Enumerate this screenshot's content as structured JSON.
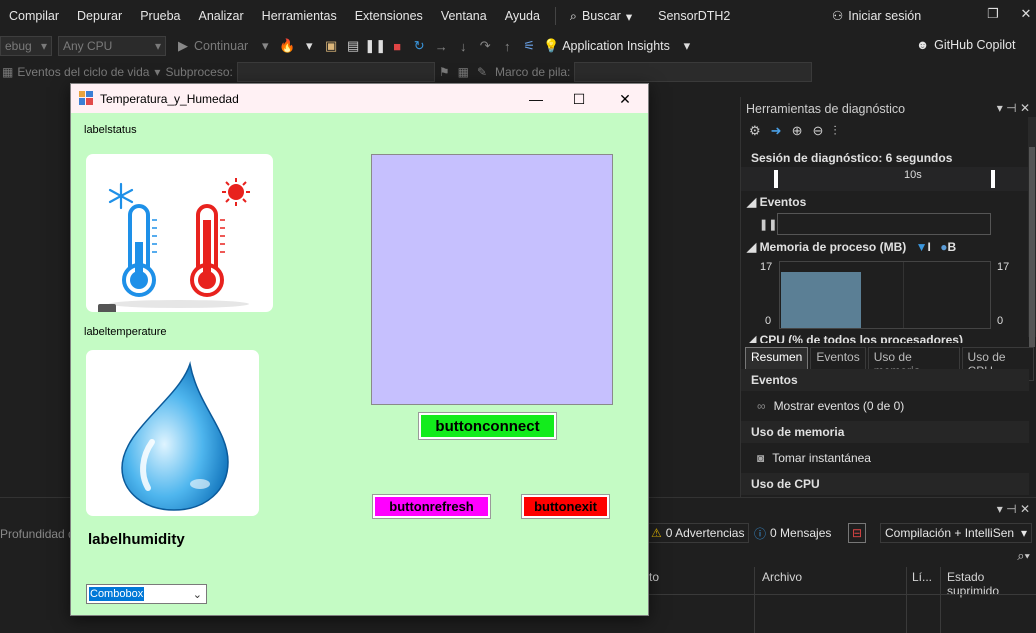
{
  "menubar": {
    "items": [
      "Compilar",
      "Depurar",
      "Prueba",
      "Analizar",
      "Herramientas",
      "Extensiones",
      "Ventana",
      "Ayuda"
    ],
    "search": "Buscar",
    "project": "SensorDTH2",
    "signin": "Iniciar sesión"
  },
  "toolbar": {
    "config": "ebug",
    "platform": "Any CPU",
    "continue": "Continuar",
    "app_insights": "Application Insights",
    "copilot": "GitHub Copilot"
  },
  "toolbar2": {
    "lifecycle": "Eventos del ciclo de vida",
    "thread_label": "Subproceso:",
    "stack_label": "Marco de pila:"
  },
  "bottom": {
    "depth": "Profundidad d",
    "warnings": "0 Advertencias",
    "messages": "0 Mensajes",
    "build_filter": "Compilación + IntelliSen",
    "col_code": "to",
    "col_file": "Archivo",
    "col_line": "Lí...",
    "col_state": "Estado suprimido"
  },
  "diagnostics": {
    "title": "Herramientas de diagnóstico",
    "session": "Sesión de diagnóstico: 6 segundos",
    "timeline_label": "10s",
    "events_header": "Eventos",
    "memory_header": "Memoria de proceso (MB)",
    "mem_legend_1": "I",
    "mem_legend_2": "B",
    "mem_max": "17",
    "mem_min": "0",
    "mem_max_r": "17",
    "mem_min_r": "0",
    "memory_level": 0.85,
    "cpu_header": "CPU (% de todos los procesadores)",
    "tabs": [
      "Resumen",
      "Eventos",
      "Uso de memoria",
      "Uso de CPU"
    ],
    "list": {
      "events_head": "Eventos",
      "show_events": "Mostrar eventos (0 de 0)",
      "memory_head": "Uso de memoria",
      "snapshot": "Tomar instantánea",
      "cpu_head": "Uso de CPU"
    }
  },
  "app": {
    "title": "Temperatura_y_Humedad",
    "label_status": "labelstatus",
    "label_temperature": "labeltemperature",
    "label_humidity": "labelhumidity",
    "btn_connect": "buttonconnect",
    "btn_refresh": "buttonrefresh",
    "btn_exit": "buttonexit",
    "combo_value": "Combobox",
    "colors": {
      "form_bg": "#c4fbc4",
      "graph_bg": "#c6c0fe",
      "connect": "#13ec1c",
      "refresh": "#ff00ff",
      "exit": "#ff0000"
    }
  }
}
